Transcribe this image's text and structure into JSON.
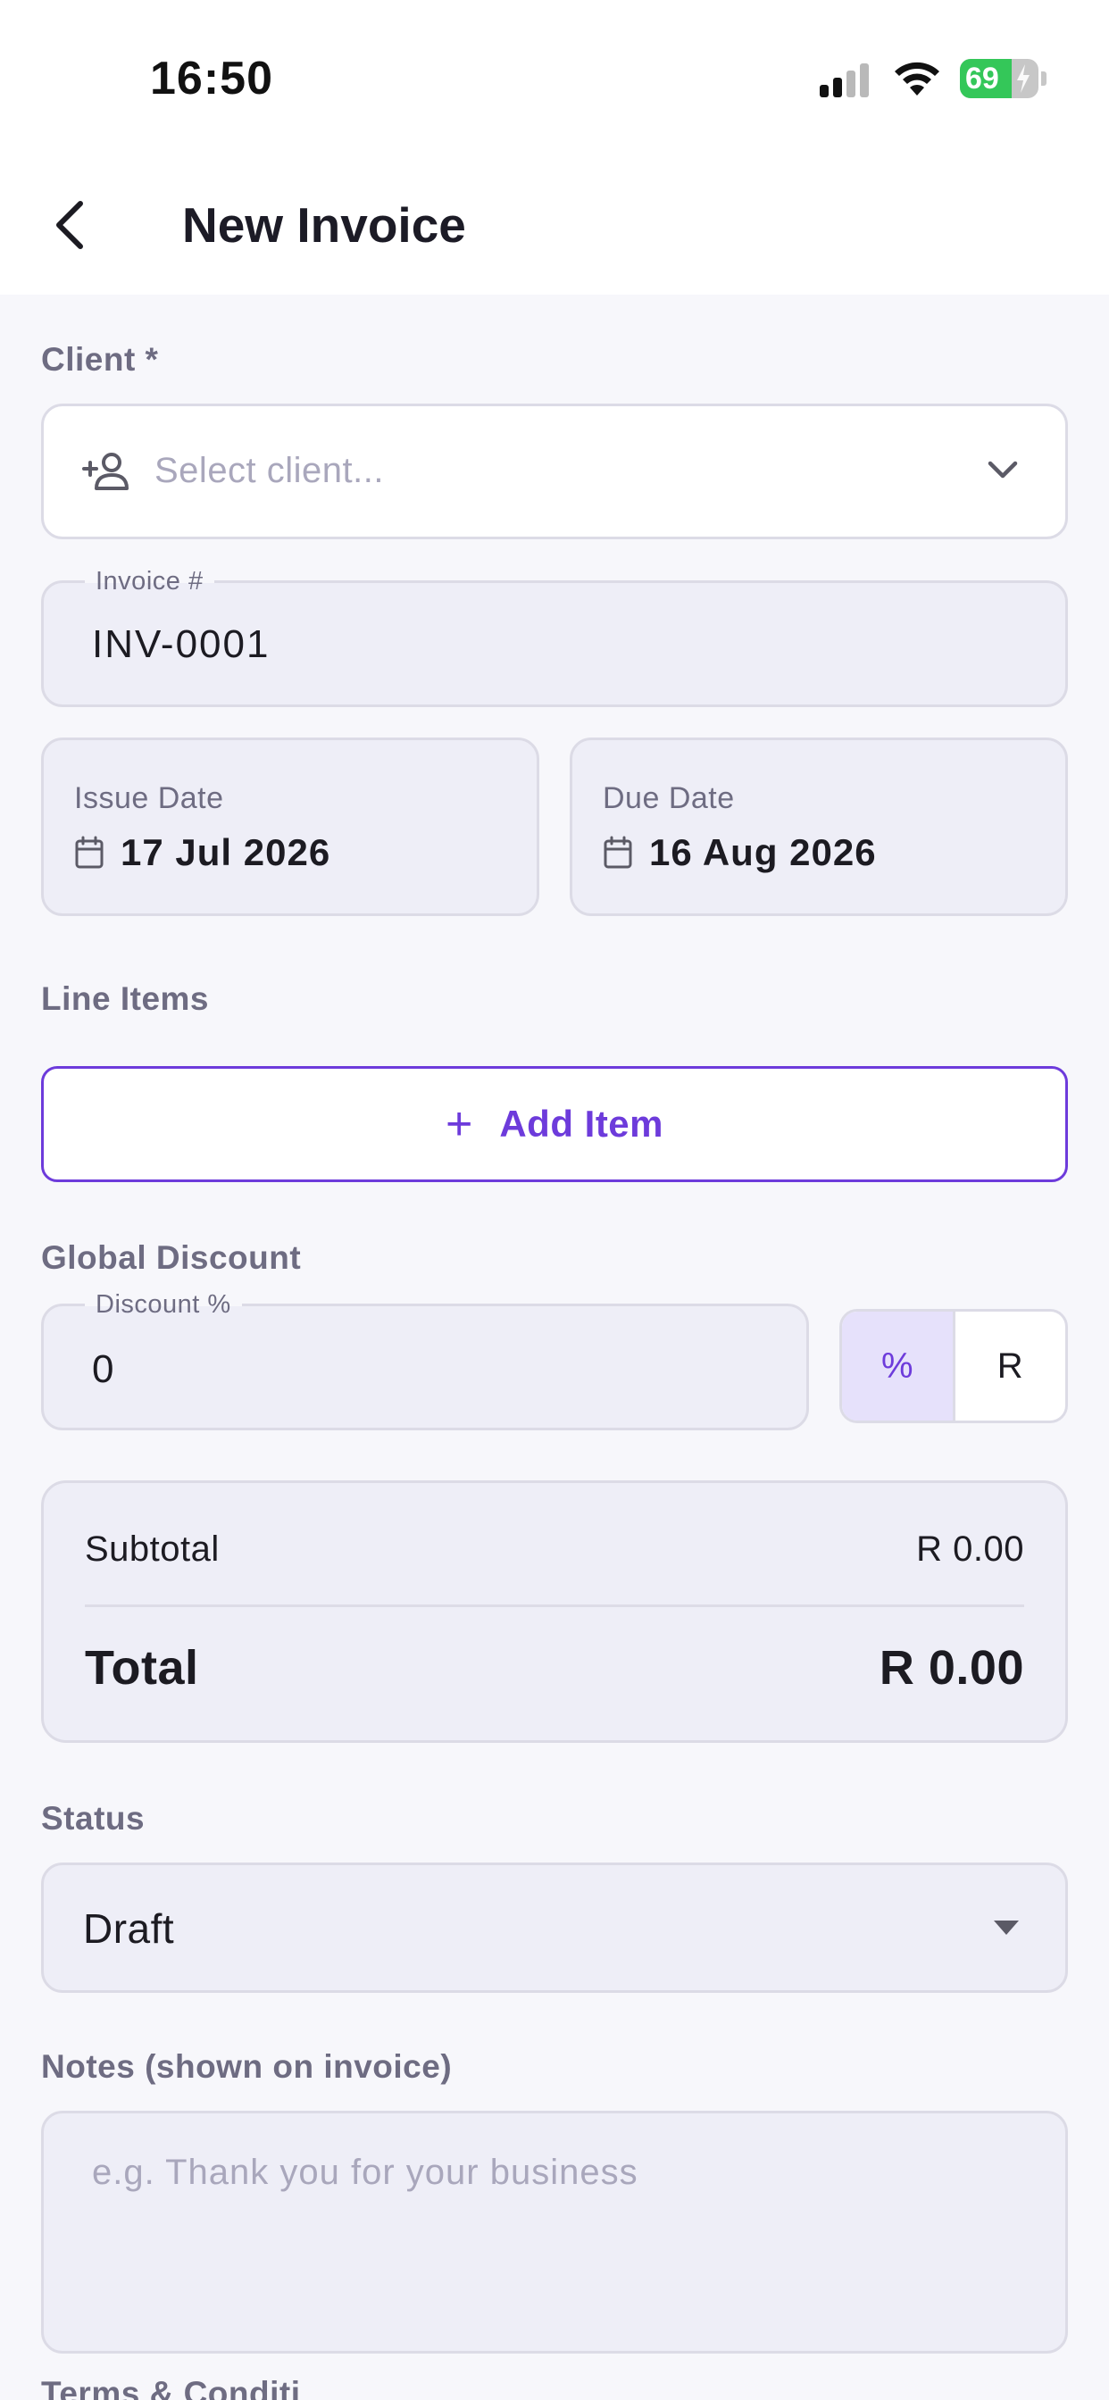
{
  "status_bar": {
    "time": "16:50",
    "battery_percent": "69",
    "icons": [
      "cellular-signal-icon",
      "wifi-icon",
      "battery-charging-icon"
    ]
  },
  "header": {
    "title": "New Invoice",
    "back_icon": "chevron-left-icon"
  },
  "client": {
    "label": "Client *",
    "placeholder": "Select client...",
    "icons": [
      "person-add-icon",
      "chevron-down-icon"
    ]
  },
  "invoice_number": {
    "label": "Invoice #",
    "value": "INV-0001"
  },
  "issue_date": {
    "label": "Issue Date",
    "value": "17 Jul 2026",
    "icon": "calendar-icon"
  },
  "due_date": {
    "label": "Due Date",
    "value": "16 Aug 2026",
    "icon": "calendar-icon"
  },
  "line_items": {
    "label": "Line Items",
    "add_button": "Add Item",
    "add_icon": "+"
  },
  "global_discount": {
    "label": "Global Discount",
    "field_label": "Discount %",
    "value": "0",
    "toggle": {
      "percent": "%",
      "rand": "R",
      "selected": "%"
    }
  },
  "totals": {
    "subtotal_label": "Subtotal",
    "subtotal_value": "R 0.00",
    "total_label": "Total",
    "total_value": "R 0.00"
  },
  "status": {
    "label": "Status",
    "value": "Draft"
  },
  "notes": {
    "label": "Notes (shown on invoice)",
    "placeholder": "e.g. Thank you for your business"
  },
  "terms": {
    "label": "Terms & Conditi"
  },
  "colors": {
    "accent": "#6d3bdb",
    "background": "#f7f7fb",
    "field": "#eeeef7",
    "border": "#dcdbe6",
    "muted_text": "#6e6c82",
    "placeholder": "#a9a7bc",
    "battery": "#34c759"
  }
}
